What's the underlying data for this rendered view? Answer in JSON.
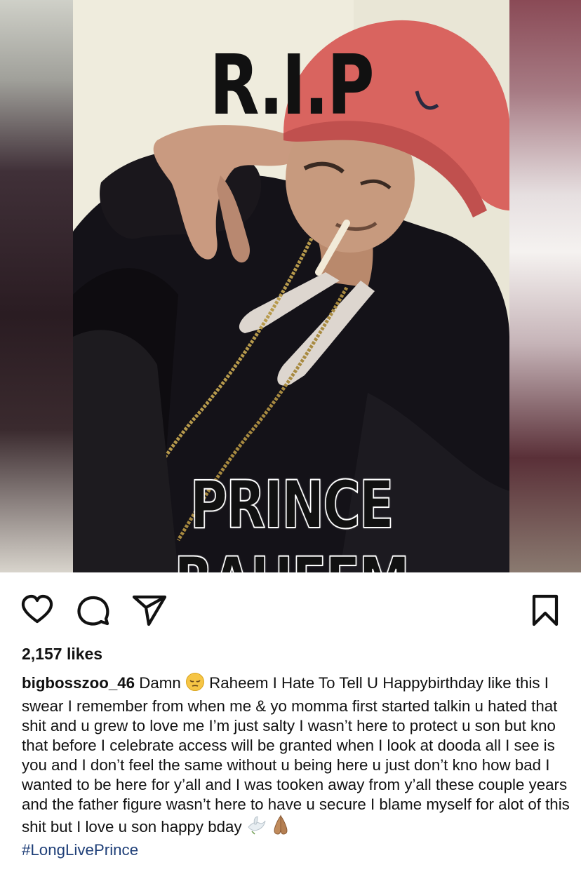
{
  "post": {
    "image": {
      "top_text": "R.I.P",
      "bottom_text": "PRINCE RAHEEM"
    },
    "icons": {
      "like": "heart-icon",
      "comment": "comment-bubble-icon",
      "share": "paper-plane-icon",
      "save": "bookmark-icon"
    },
    "likes_label": "2,157 likes",
    "caption": {
      "username": "bigbosszoo_46",
      "text_part1": "Damn",
      "emoji1": "pensive-face-emoji",
      "text_part2": "Raheem I Hate To Tell U Happybirthday like this I swear I remember from when me & yo momma first started talkin u hated that shit and u grew to love me I’m just salty I wasn’t here to protect u son but kno that before I celebrate access will be granted when I look at dooda all I see is you and I don’t feel the same without u being here u just don’t kno how bad I wanted to be here for y’all and I was tooken away from y’all these couple years and the father figure wasn’t here to have u secure I blame myself for alot of this shit but I love u son happy bday",
      "emoji2": "dove-emoji",
      "emoji3": "folded-hands-emoji",
      "hashtag": "#LongLivePrince"
    },
    "colors": {
      "hashtag": "#1f3f78",
      "text": "#111111"
    }
  }
}
